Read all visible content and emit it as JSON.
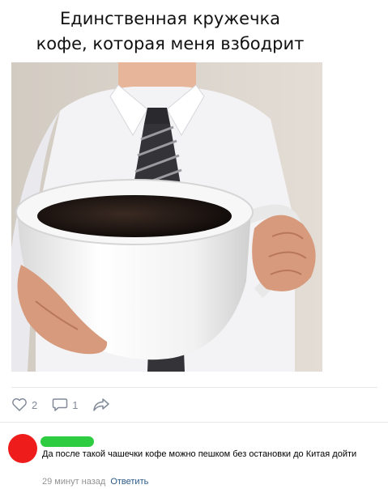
{
  "post": {
    "caption_line1": "Единственная кружечка",
    "caption_line2": "кофе, которая меня взбодрит",
    "actions": {
      "likes": {
        "icon": "heart-icon",
        "count": "2"
      },
      "comments": {
        "icon": "comment-icon",
        "count": "1"
      },
      "share": {
        "icon": "share-icon"
      }
    }
  },
  "comment": {
    "avatar_color": "#ef1c1c",
    "name_bar_color": "#2ecc40",
    "text": "Да после такой чашечки кофе можно пешком без остановки до Китая дойти",
    "time": "29 минут назад",
    "reply_label": "Ответить"
  },
  "colors": {
    "muted": "#828a99",
    "link": "#2a5885"
  }
}
